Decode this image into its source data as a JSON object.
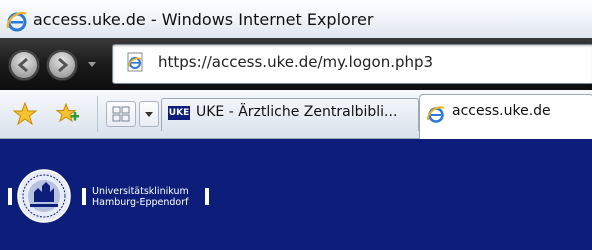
{
  "window": {
    "title": "access.uke.de - Windows Internet Explorer",
    "app_icon": "ie-logo-icon"
  },
  "navigation": {
    "back_icon": "back-arrow-icon",
    "forward_icon": "forward-arrow-icon",
    "address_url": "https://access.uke.de/my.logon.php3",
    "address_icon": "page-icon"
  },
  "tabs_bar": {
    "favorites_icon": "favorites-star-icon",
    "add_favorite_icon": "add-to-favorites-icon",
    "quick_tabs_icon": "quick-tabs-icon",
    "tab_list_icon": "tab-list-dropdown-icon",
    "tabs": [
      {
        "label": "UKE - Ärztliche Zentralbibli...",
        "icon_text": "UKE",
        "active": false
      },
      {
        "label": "access.uke.de",
        "icon": "ie-page-icon",
        "active": true
      }
    ]
  },
  "page": {
    "background_color": "#0c1e7a",
    "logo": {
      "seal_icon": "university-seal-icon",
      "line1": "Universitätsklinikum",
      "line2": "Hamburg-Eppendorf"
    }
  }
}
